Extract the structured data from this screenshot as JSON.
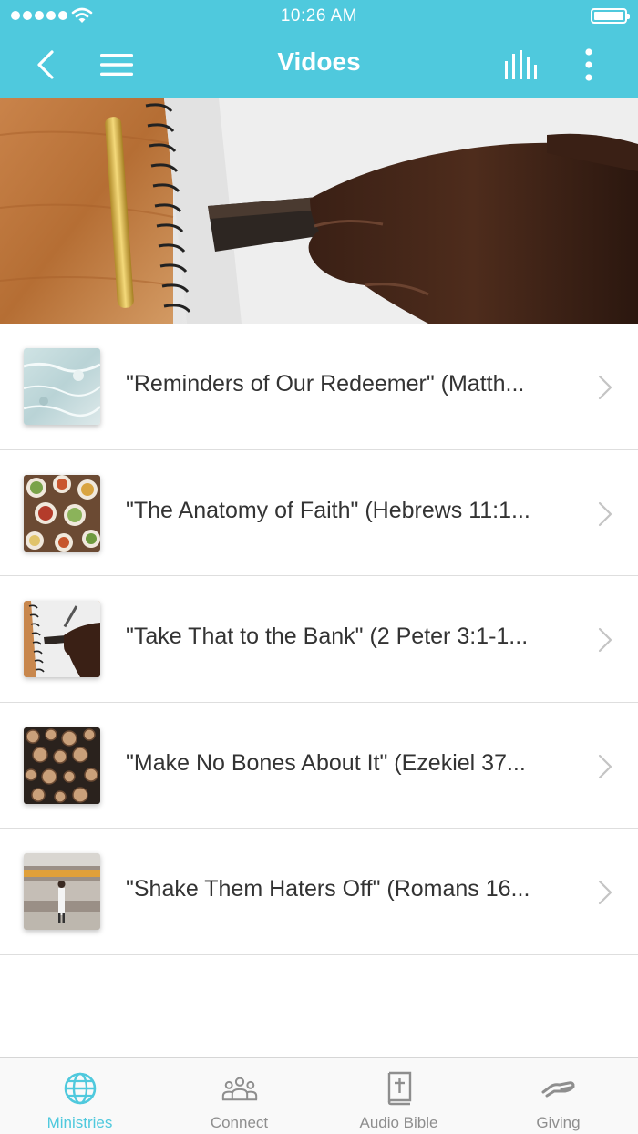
{
  "status_bar": {
    "time": "10:26 AM"
  },
  "header": {
    "title": "Vidoes"
  },
  "videos": [
    {
      "title": "\"Reminders of Our Redeemer\" (Matth..."
    },
    {
      "title": "\"The Anatomy of Faith\" (Hebrews 11:1..."
    },
    {
      "title": "\"Take That to the Bank\" (2 Peter 3:1-1..."
    },
    {
      "title": "\"Make No Bones About It\" (Ezekiel 37..."
    },
    {
      "title": "\"Shake Them Haters Off\" (Romans 16..."
    }
  ],
  "tabs": [
    {
      "label": "Ministries",
      "icon": "globe-icon",
      "active": true
    },
    {
      "label": "Connect",
      "icon": "people-icon",
      "active": false
    },
    {
      "label": "Audio Bible",
      "icon": "bible-icon",
      "active": false
    },
    {
      "label": "Giving",
      "icon": "giving-hand-icon",
      "active": false
    }
  ],
  "colors": {
    "accent": "#4fc9dd",
    "tab_inactive": "#8e8e8e",
    "text": "#333333"
  }
}
